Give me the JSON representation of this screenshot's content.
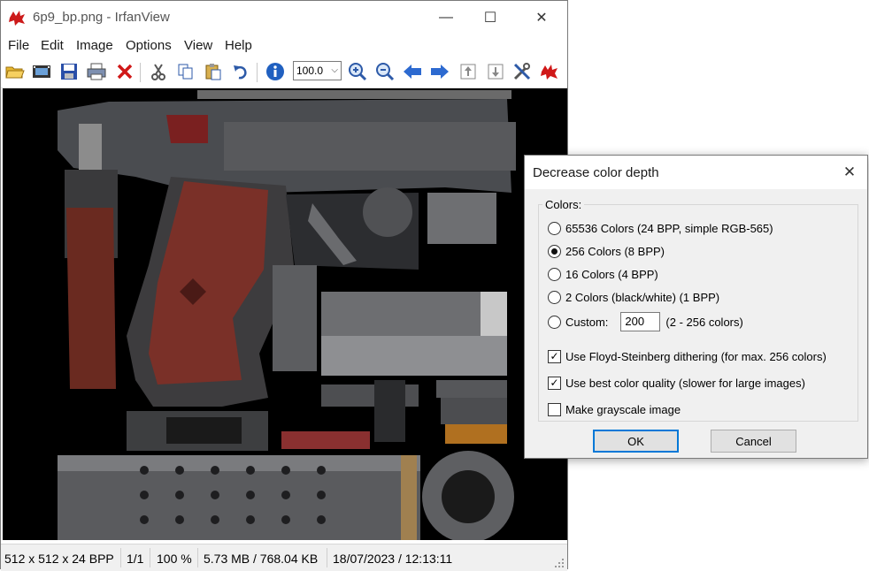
{
  "window": {
    "title": "6p9_bp.png - IrfanView",
    "minimize": "—",
    "maximize": "☐",
    "close": "✕"
  },
  "menu": [
    "File",
    "Edit",
    "Image",
    "Options",
    "View",
    "Help"
  ],
  "toolbar": {
    "zoom_value": "100.0",
    "icons": [
      "open-folder-icon",
      "slideshow-icon",
      "save-icon",
      "print-icon",
      "delete-icon",
      "cut-icon",
      "copy-icon",
      "paste-icon",
      "undo-icon",
      "info-icon",
      "zoom-in-icon",
      "zoom-out-icon",
      "previous-icon",
      "next-icon",
      "first-page-icon",
      "last-page-icon",
      "settings-icon",
      "irfanview-icon"
    ]
  },
  "status": {
    "dimensions": "512 x 512 x 24 BPP",
    "page": "1/1",
    "zoom": "100 %",
    "size": "5.73 MB / 768.04 KB",
    "datetime": "18/07/2023 / 12:13:11"
  },
  "dialog": {
    "title": "Decrease color depth",
    "close": "✕",
    "group_label": "Colors:",
    "radios": [
      {
        "label": "65536 Colors (24 BPP, simple RGB-565)",
        "selected": false
      },
      {
        "label": "256 Colors (8 BPP)",
        "selected": true
      },
      {
        "label": "16 Colors (4 BPP)",
        "selected": false
      },
      {
        "label": "2 Colors (black/white) (1 BPP)",
        "selected": false
      }
    ],
    "custom_label": "Custom:",
    "custom_value": "200",
    "custom_range": "(2 - 256 colors)",
    "checkboxes": [
      {
        "label": "Use Floyd-Steinberg dithering (for max. 256 colors)",
        "checked": true
      },
      {
        "label": "Use best color quality (slower for large images)",
        "checked": true
      },
      {
        "label": "Make grayscale image",
        "checked": false
      }
    ],
    "ok": "OK",
    "cancel": "Cancel"
  }
}
